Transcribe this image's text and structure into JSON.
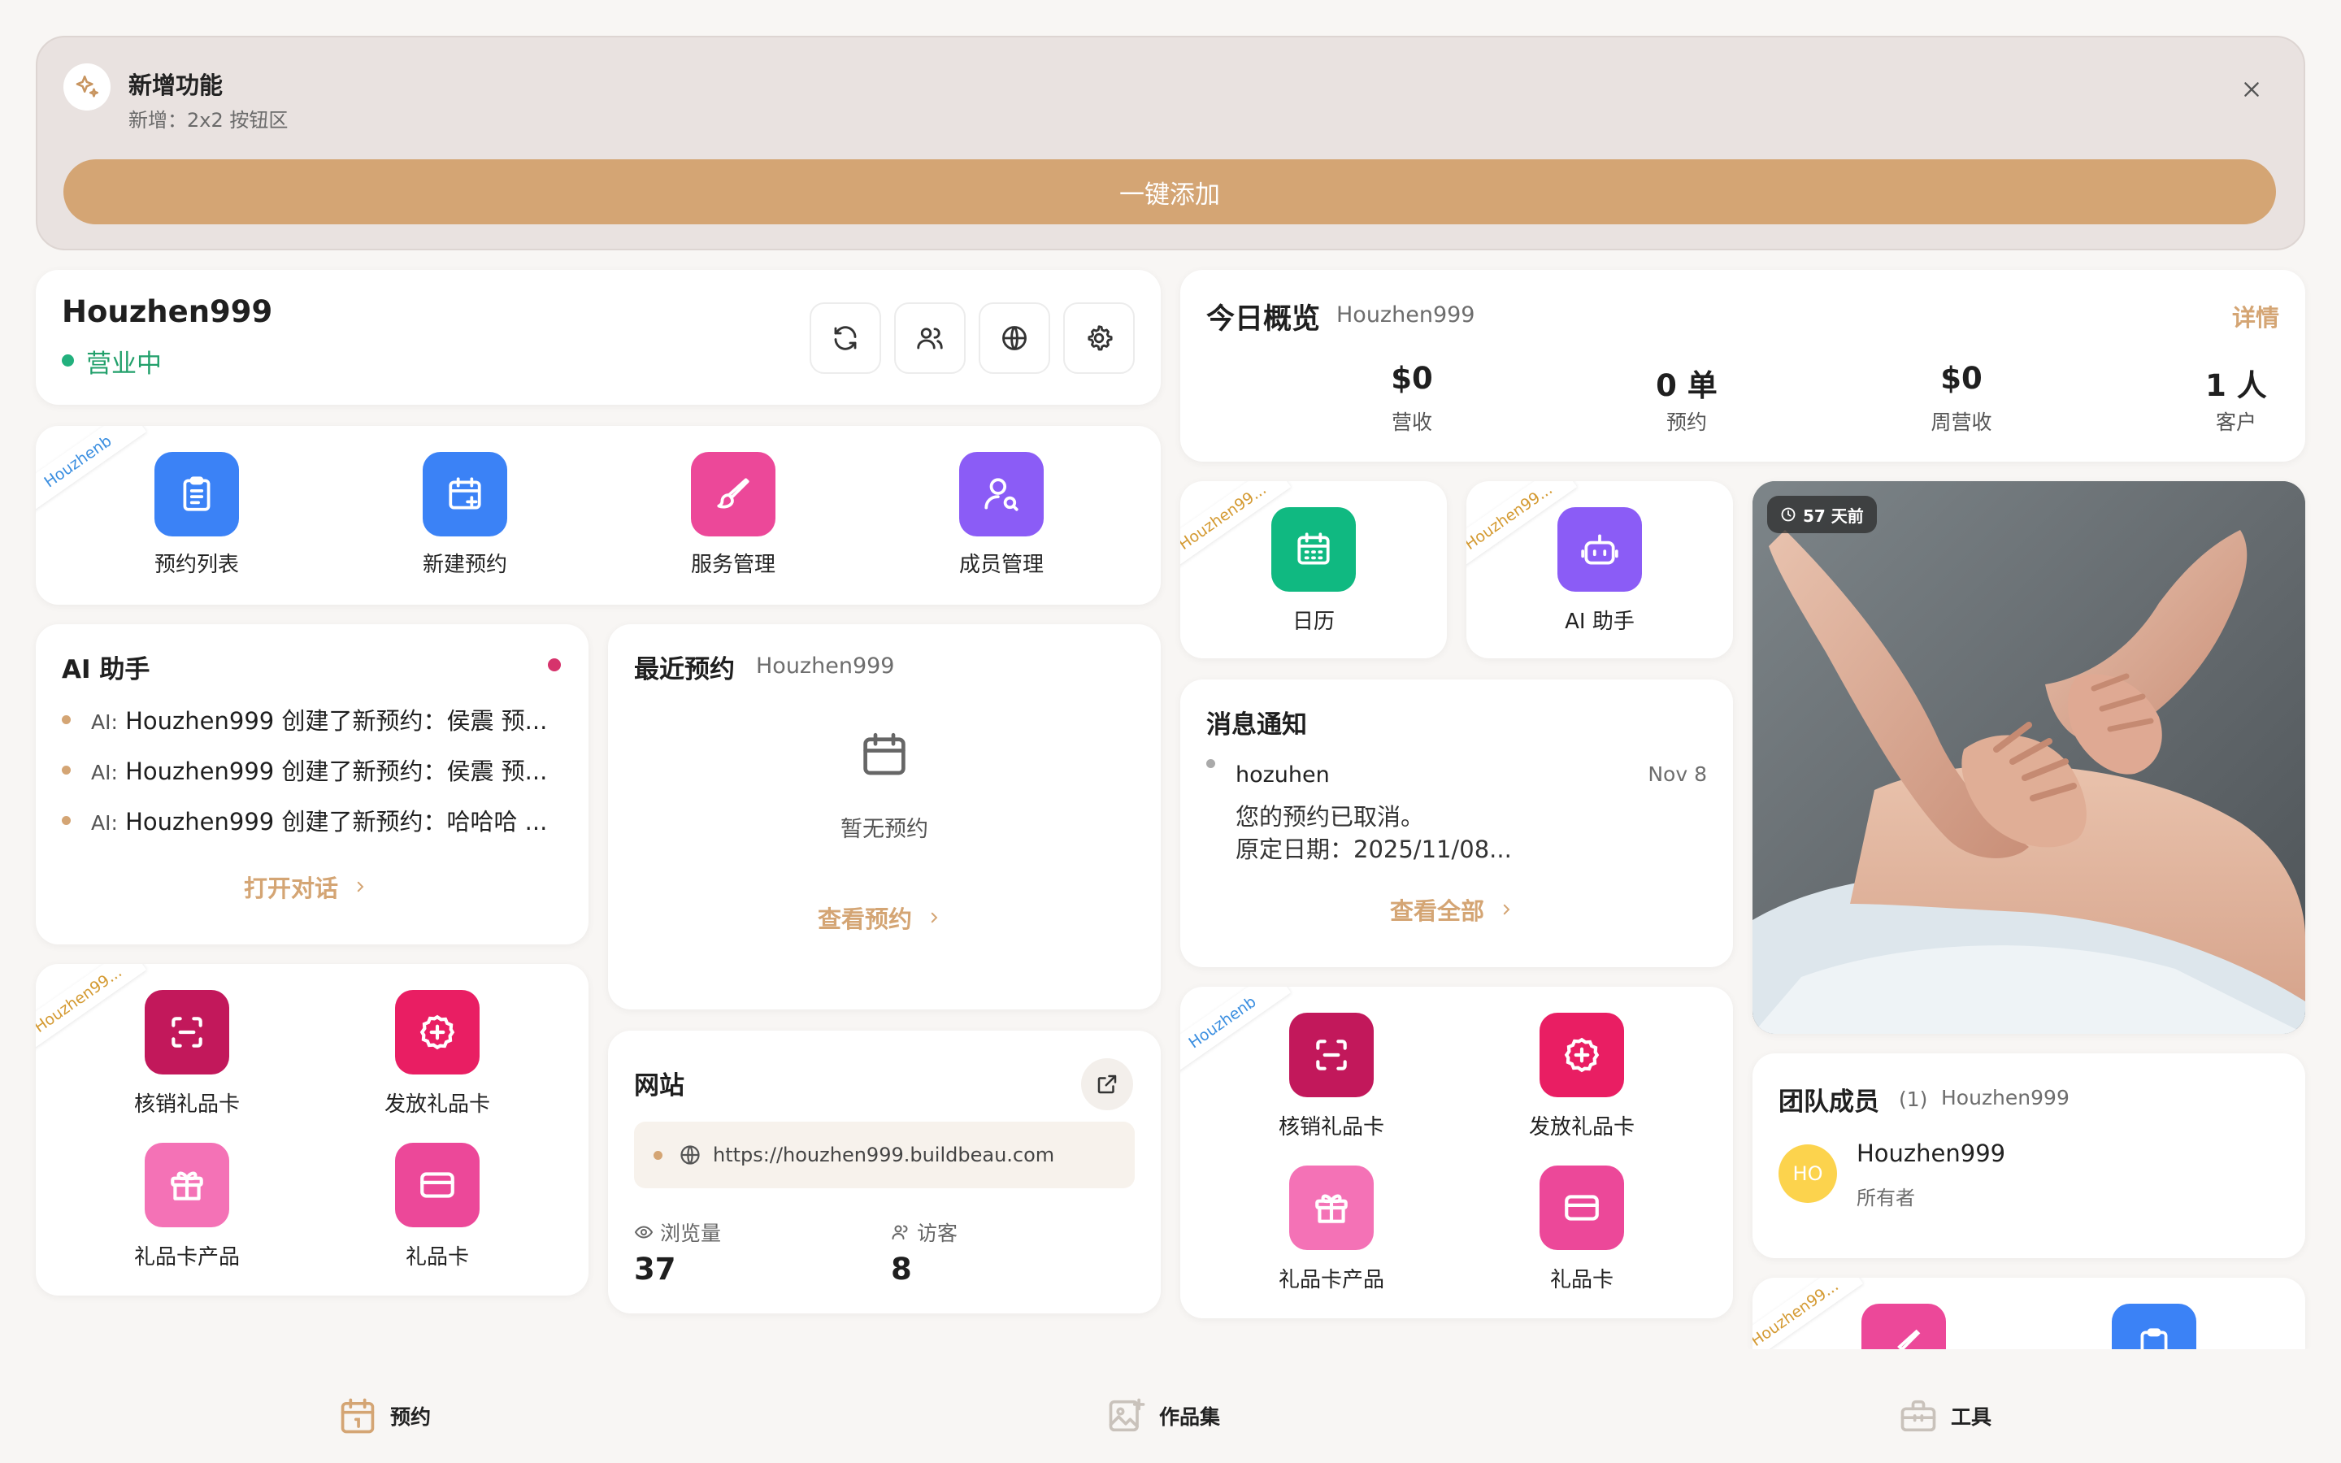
{
  "banner": {
    "title": "新增功能",
    "subtitle": "新增：2x2 按钮区",
    "action": "一键添加",
    "icon": "sparkles-icon"
  },
  "business": {
    "name": "Houzhen999",
    "status": "营业中",
    "status_color": "#22b07d"
  },
  "ribbons": {
    "short": "Houzhenb",
    "long": "Houzhen99..."
  },
  "quick_actions": [
    {
      "label": "预约列表",
      "color": "#3b82f6",
      "icon": "clipboard-list-icon"
    },
    {
      "label": "新建预约",
      "color": "#3b82f6",
      "icon": "calendar-plus-icon"
    },
    {
      "label": "服务管理",
      "color": "#ec4899",
      "icon": "brush-icon"
    },
    {
      "label": "成员管理",
      "color": "#8b5cf6",
      "icon": "user-search-icon"
    }
  ],
  "overview": {
    "title": "今日概览",
    "business": "Houzhen999",
    "details_link": "详情",
    "stats": [
      {
        "value": "$0",
        "label": "营收"
      },
      {
        "value": "0 单",
        "label": "预约"
      },
      {
        "value": "$0",
        "label": "周营收"
      },
      {
        "value": "1 人",
        "label": "客户"
      }
    ]
  },
  "mini_tiles": [
    {
      "label": "日历",
      "color": "#10b981",
      "icon": "calendar-icon"
    },
    {
      "label": "AI 助手",
      "color": "#8b5cf6",
      "icon": "robot-icon"
    }
  ],
  "photo": {
    "badge": "57 天前"
  },
  "ai": {
    "title": "AI 助手",
    "items": [
      {
        "prefix": "AI:",
        "text": "Houzhen999 创建了新预约：侯震 预..."
      },
      {
        "prefix": "AI:",
        "text": "Houzhen999 创建了新预约：侯震 预..."
      },
      {
        "prefix": "AI:",
        "text": "Houzhen999 创建了新预约：哈哈哈 ..."
      }
    ],
    "open_link": "打开对话"
  },
  "recent": {
    "title": "最近预约",
    "business": "Houzhen999",
    "empty": "暂无预约",
    "view_link": "查看预约"
  },
  "messages": {
    "title": "消息通知",
    "sender": "hozuhen",
    "date": "Nov 8",
    "line1": "您的预约已取消。",
    "line2": "原定日期：2025/11/08...",
    "view_all": "查看全部"
  },
  "gift_tiles": [
    {
      "label": "核销礼品卡",
      "color": "#c2185b",
      "icon": "scan-icon"
    },
    {
      "label": "发放礼品卡",
      "color": "#e91e63",
      "icon": "plus-badge-icon"
    },
    {
      "label": "礼品卡产品",
      "color": "#f472b6",
      "icon": "gift-icon"
    },
    {
      "label": "礼品卡",
      "color": "#ec4899",
      "icon": "card-icon"
    }
  ],
  "website": {
    "title": "网站",
    "url": "https://houzhen999.buildbeau.com",
    "views_label": "浏览量",
    "views": "37",
    "visitors_label": "访客",
    "visitors": "8"
  },
  "team": {
    "title": "团队成员",
    "count": "(1)",
    "business": "Houzhen999",
    "member_initials": "HO",
    "member_name": "Houzhen999",
    "member_role": "所有者",
    "avatar_color": "#fcd34d"
  },
  "bottom_nav": [
    {
      "label": "预约",
      "icon": "calendar-day-icon"
    },
    {
      "label": "作品集",
      "icon": "image-plus-icon"
    },
    {
      "label": "工具",
      "icon": "toolbox-icon"
    }
  ]
}
